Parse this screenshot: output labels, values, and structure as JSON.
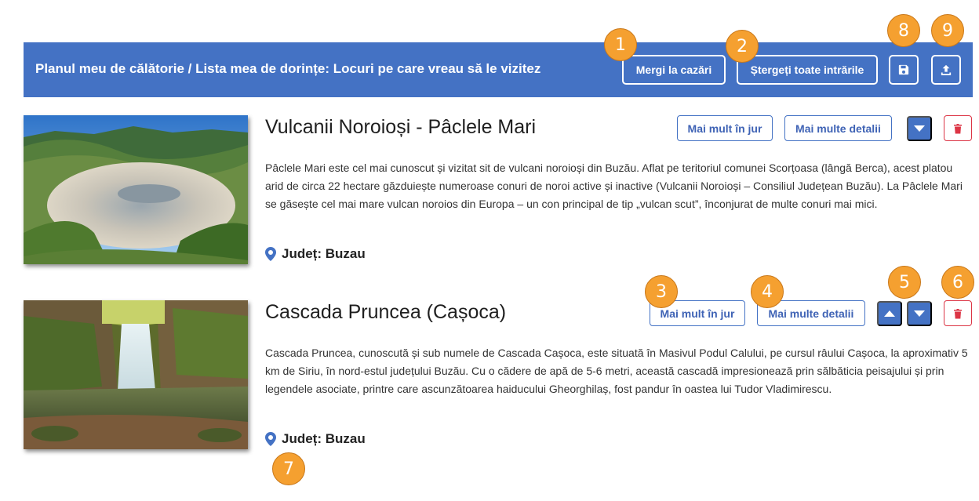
{
  "header": {
    "title": "Planul meu de călătorie / Lista mea de dorințe: Locuri pe care vreau să le vizitez",
    "go_to_accommodation": "Mergi la cazări",
    "delete_all": "Ștergeți toate intrările",
    "save_icon": "save-icon",
    "share_icon": "upload-icon"
  },
  "places": [
    {
      "title": "Vulcanii Noroioși - Pâclele Mari",
      "description": "Pâclele Mari este cel mai cunoscut și vizitat sit de vulcani noroioși din Buzău. Aflat pe teritoriul comunei Scorțoasa (lângă Berca), acest platou arid de circa 22 hectare găzduiește numeroase conuri de noroi active și inactive (Vulcanii Noroioși – Consiliul Județean Buzău). La Pâclele Mari se găsește cel mai mare vulcan noroios din Europa – un con principal de tip „vulcan scut”, înconjurat de multe conuri mai mici.",
      "county": "Județ: Buzau",
      "nearby_label": "Mai mult în jur",
      "details_label": "Mai multe detalii"
    },
    {
      "title": "Cascada Pruncea (Cașoca)",
      "description": "Cascada Pruncea, cunoscută și sub numele de Cascada Cașoca, este situată în Masivul Podul Calului, pe cursul râului Cașoca, la aproximativ 5 km de Siriu, în nord-estul județului Buzău. Cu o cădere de apă de 5-6 metri, această cascadă impresionează prin sălbăticia peisajului și prin legendele asociate, printre care ascunzătoarea haiducului Gheorghilaș, fost pandur în oastea lui Tudor Vladimirescu.",
      "county": "Județ: Buzau",
      "nearby_label": "Mai mult în jur",
      "details_label": "Mai multe detalii"
    }
  ],
  "markers": [
    "1",
    "2",
    "3",
    "4",
    "5",
    "6",
    "7",
    "8",
    "9"
  ],
  "colors": {
    "primary": "#4472c4",
    "danger": "#dc3545",
    "marker": "#f5a030"
  }
}
